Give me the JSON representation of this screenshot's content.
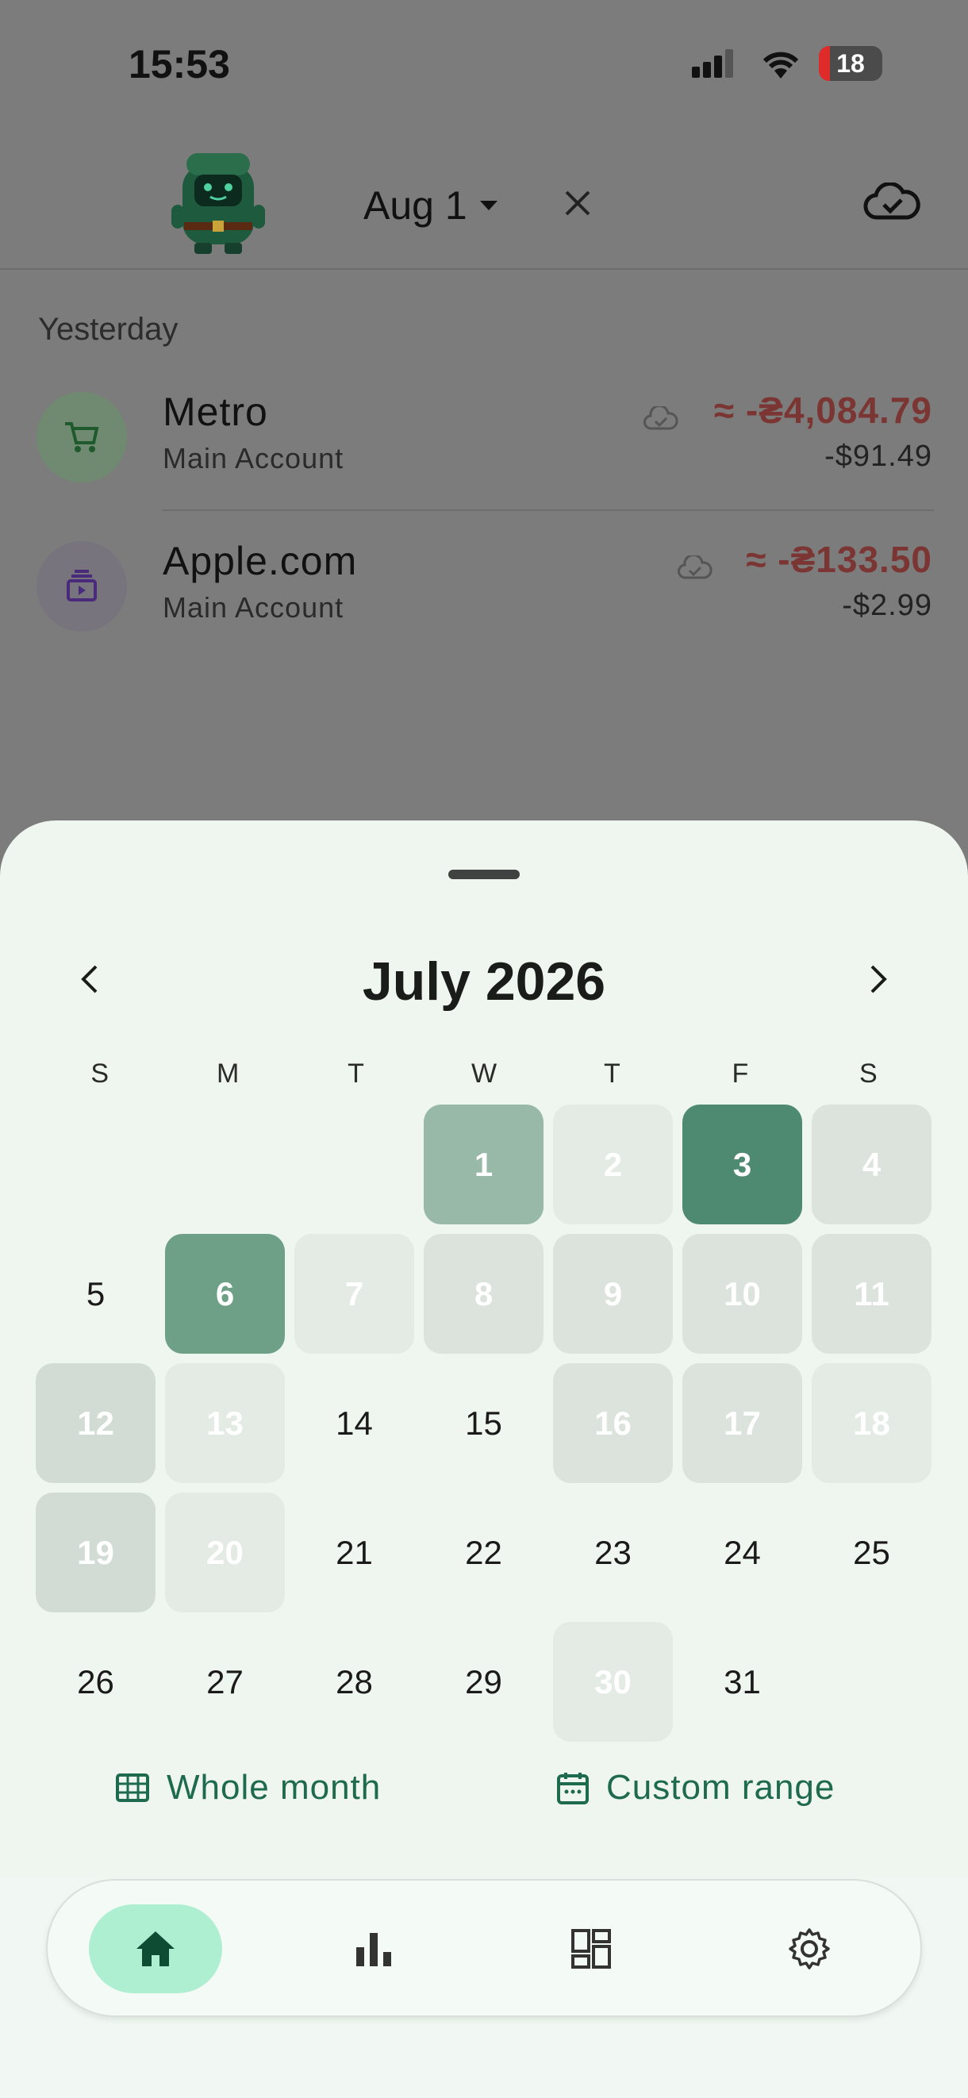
{
  "status_bar": {
    "time": "15:53",
    "battery": "18"
  },
  "header": {
    "date_label": "Aug 1"
  },
  "list": {
    "section_label": "Yesterday",
    "transactions": [
      {
        "name": "Metro",
        "account": "Main Account",
        "amount": "≈ -₴4,084.79",
        "usd": "-$91.49",
        "icon": "cart-icon"
      },
      {
        "name": "Apple.com",
        "account": "Main Account",
        "amount": "≈ -₴133.50",
        "usd": "-$2.99",
        "icon": "subscription-icon"
      }
    ]
  },
  "calendar": {
    "title": "July 2026",
    "weekdays": [
      "S",
      "M",
      "T",
      "W",
      "T",
      "F",
      "S"
    ],
    "days": [
      "1",
      "2",
      "3",
      "4",
      "5",
      "6",
      "7",
      "8",
      "9",
      "10",
      "11",
      "12",
      "13",
      "14",
      "15",
      "16",
      "17",
      "18",
      "19",
      "20",
      "21",
      "22",
      "23",
      "24",
      "25",
      "26",
      "27",
      "28",
      "29",
      "30",
      "31"
    ],
    "whole_month_label": "Whole month",
    "custom_range_label": "Custom range"
  },
  "colors": {
    "accent": "#1e6a4f",
    "selected_strong": "#4e8a72",
    "active_nav": "#aeefd2",
    "expense": "#7b3533"
  },
  "nav": {
    "items": [
      "home-icon",
      "chart-icon",
      "dashboard-icon",
      "settings-icon"
    ],
    "active": "home-icon"
  }
}
